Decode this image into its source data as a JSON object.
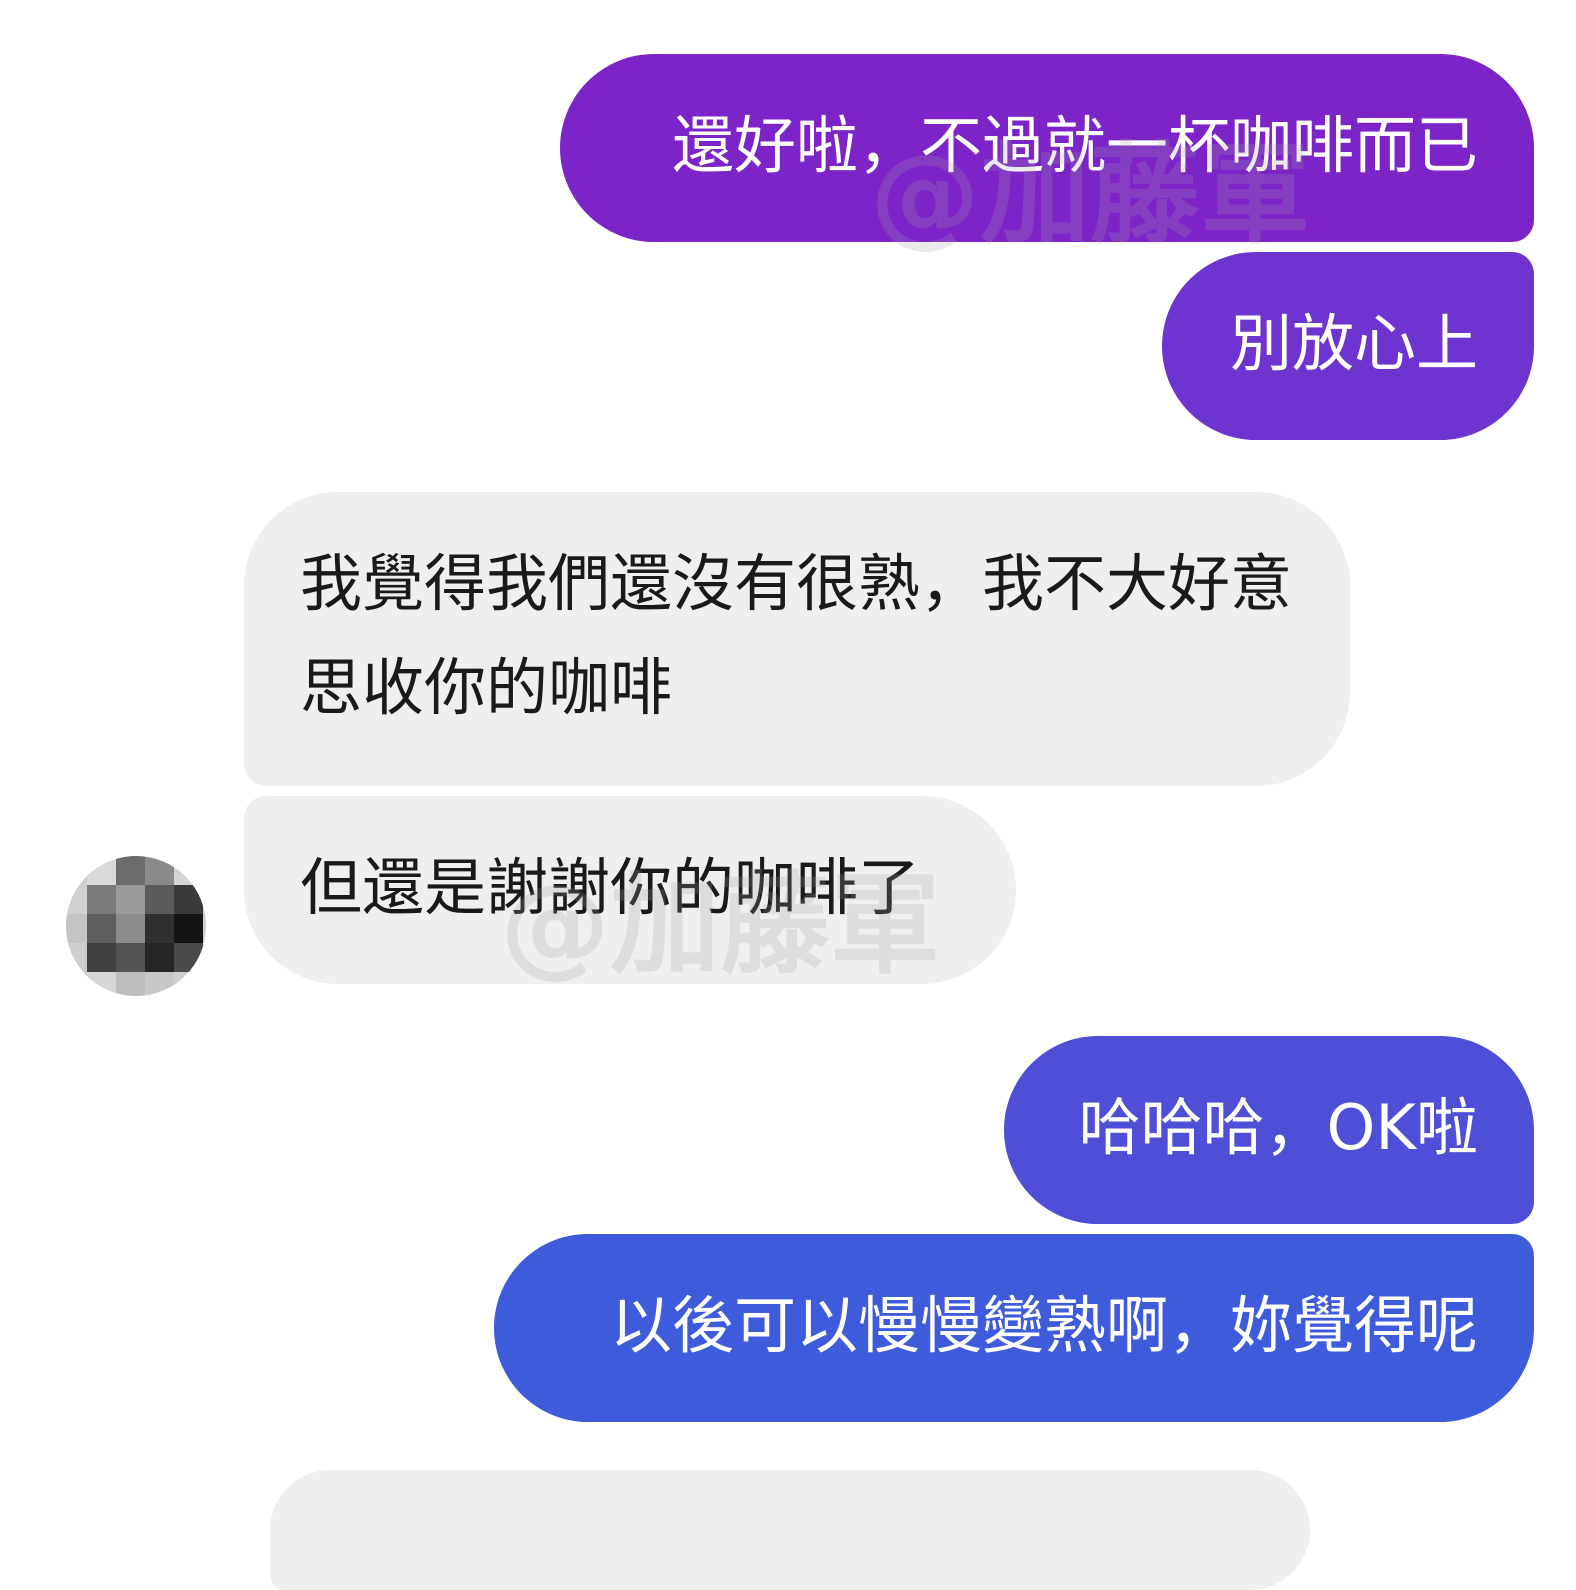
{
  "conversation": {
    "messages": [
      {
        "sender": "me",
        "text": "還好啦，不過就一杯咖啡而已"
      },
      {
        "sender": "me",
        "text": "別放心上"
      },
      {
        "sender": "them",
        "text": "我覺得我們還沒有很熟，我不大好意思收你的咖啡"
      },
      {
        "sender": "them",
        "text": "但還是謝謝你的咖啡了"
      },
      {
        "sender": "me",
        "text": "哈哈哈，OK啦"
      },
      {
        "sender": "me",
        "text": "以後可以慢慢變熟啊，妳覺得呢"
      },
      {
        "sender": "them",
        "text": ""
      }
    ]
  },
  "contact": {
    "avatar_icon": "pixelated-avatar"
  },
  "watermarks": [
    "@加藤軍",
    "@加藤軍"
  ],
  "colors": {
    "sent_gradient_top": "#7d24c9",
    "sent_gradient_mid": "#6e34cf",
    "sent_gradient_low": "#4f4ed7",
    "sent_gradient_bottom": "#3e5bdb",
    "received_bubble": "#efefef",
    "received_text": "#1a1a1a",
    "background": "#ffffff"
  }
}
